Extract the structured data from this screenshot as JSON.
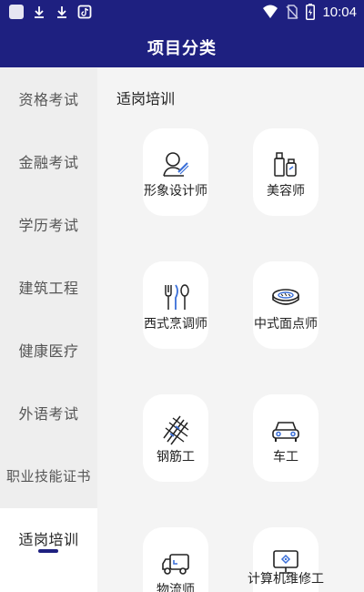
{
  "status_bar": {
    "time": "10:04",
    "left_icons": [
      "app-square-icon",
      "download-icon",
      "download-icon",
      "tiktok-icon"
    ],
    "right_icons": [
      "wifi-icon",
      "no-sim-icon",
      "battery-icon"
    ]
  },
  "header": {
    "title": "项目分类"
  },
  "sidebar": {
    "items": [
      {
        "label": "资格考试"
      },
      {
        "label": "金融考试"
      },
      {
        "label": "学历考试"
      },
      {
        "label": "建筑工程"
      },
      {
        "label": "健康医疗"
      },
      {
        "label": "外语考试"
      },
      {
        "label": "职业技能证书"
      },
      {
        "label": "适岗培训"
      }
    ],
    "active_index": 7
  },
  "content": {
    "section_title": "适岗培训",
    "cards": [
      {
        "label": "形象设计师",
        "icon": "makeup-artist-icon"
      },
      {
        "label": "美容师",
        "icon": "cosmetics-icon"
      },
      {
        "label": "西式烹调师",
        "icon": "cutlery-icon"
      },
      {
        "label": "中式面点师",
        "icon": "steamer-icon"
      },
      {
        "label": "钢筋工",
        "icon": "rebar-icon"
      },
      {
        "label": "车工",
        "icon": "car-icon"
      },
      {
        "label": "物流师",
        "icon": "truck-icon"
      },
      {
        "label": "计算机维修工",
        "icon": "computer-icon"
      }
    ]
  },
  "colors": {
    "brand": "#1e2080",
    "sidebar_bg": "#eeeeee",
    "content_bg": "#f4f4f4",
    "card_bg": "#ffffff"
  }
}
